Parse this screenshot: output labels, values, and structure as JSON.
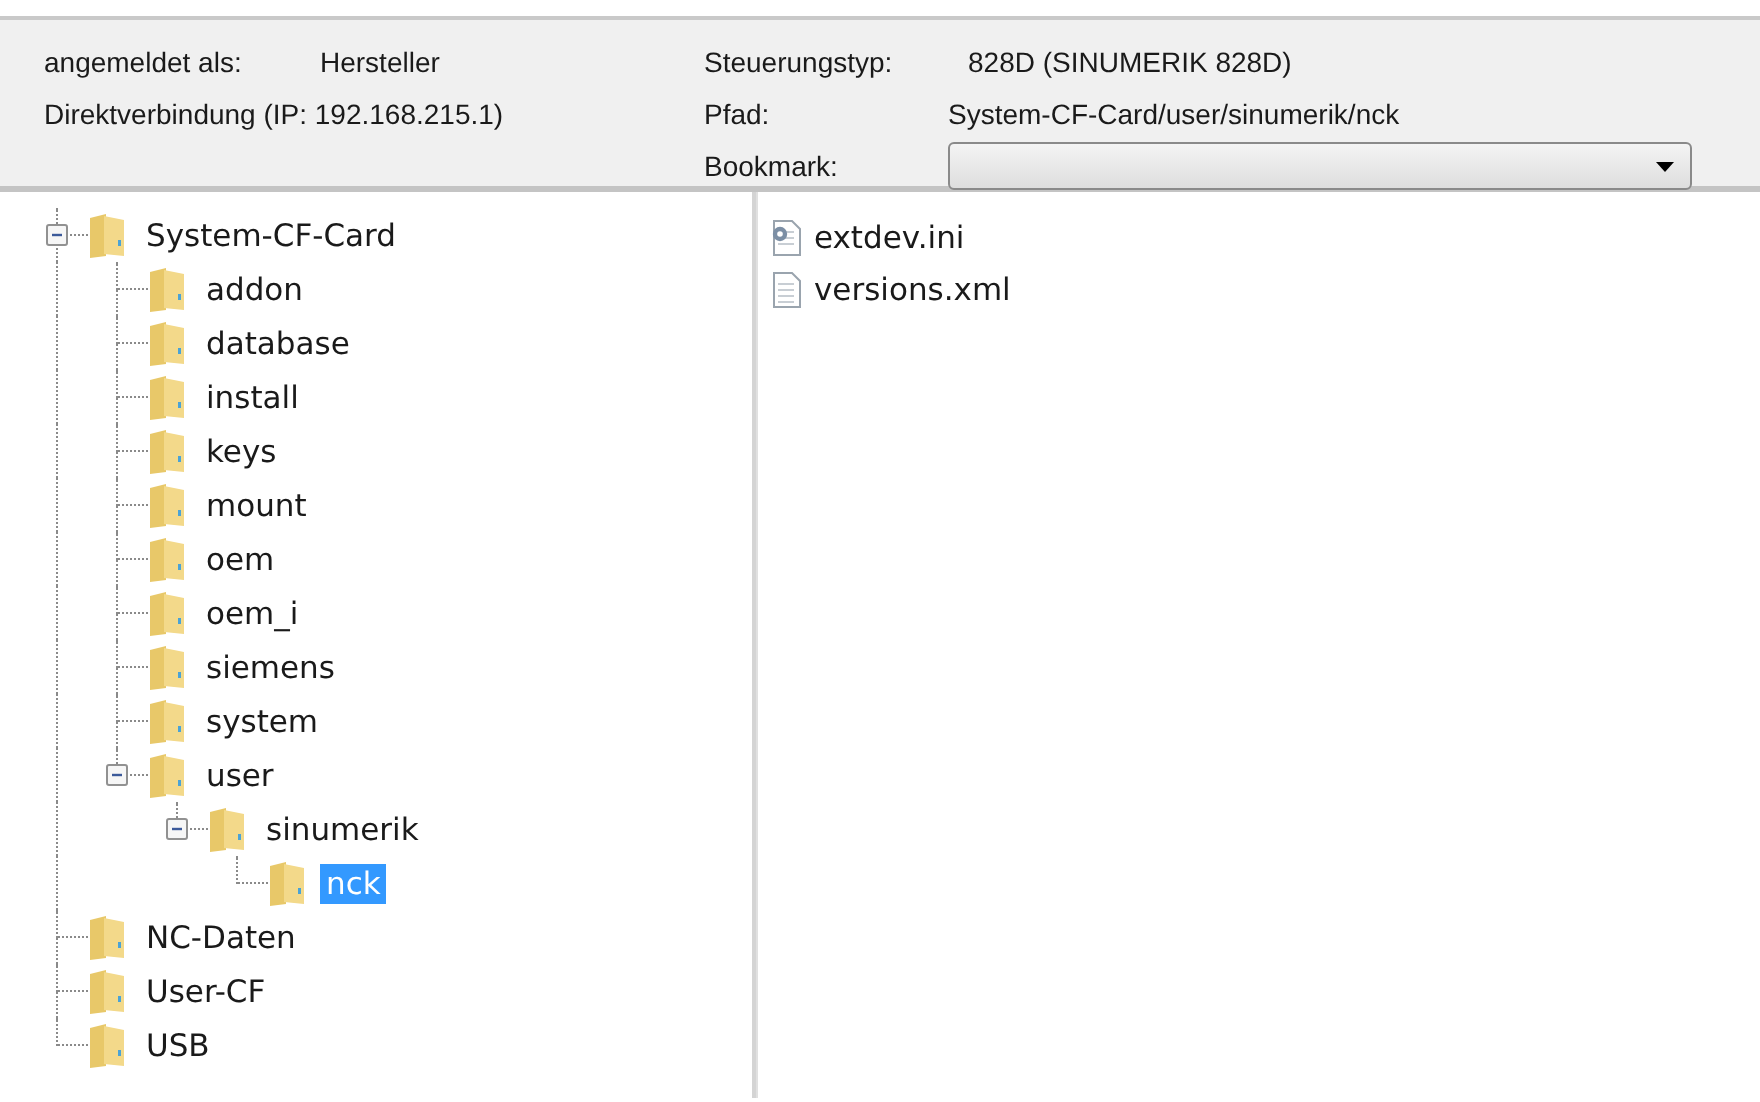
{
  "header": {
    "login_label": "angemeldet als:",
    "login_value": "Hersteller",
    "connection": "Direktverbindung (IP: 192.168.215.1)",
    "control_type_label": "Steuerungstyp:",
    "control_type_value": "828D (SINUMERIK 828D)",
    "path_label": "Pfad:",
    "path_value": "System-CF-Card/user/sinumerik/nck",
    "bookmark_label": "Bookmark:"
  },
  "tree": [
    {
      "label": "System-CF-Card",
      "expanded": true,
      "selected": false,
      "children": [
        {
          "label": "addon",
          "selected": false
        },
        {
          "label": "database",
          "selected": false
        },
        {
          "label": "install",
          "selected": false
        },
        {
          "label": "keys",
          "selected": false
        },
        {
          "label": "mount",
          "selected": false
        },
        {
          "label": "oem",
          "selected": false
        },
        {
          "label": "oem_i",
          "selected": false
        },
        {
          "label": "siemens",
          "selected": false
        },
        {
          "label": "system",
          "selected": false
        },
        {
          "label": "user",
          "expanded": true,
          "selected": false,
          "children": [
            {
              "label": "sinumerik",
              "expanded": true,
              "selected": false,
              "children": [
                {
                  "label": "nck",
                  "selected": true
                }
              ]
            }
          ]
        }
      ]
    },
    {
      "label": "NC-Daten",
      "selected": false
    },
    {
      "label": "User-CF",
      "selected": false
    },
    {
      "label": "USB",
      "selected": false
    }
  ],
  "files": [
    {
      "name": "extdev.ini",
      "kind": "config"
    },
    {
      "name": "versions.xml",
      "kind": "text"
    }
  ]
}
